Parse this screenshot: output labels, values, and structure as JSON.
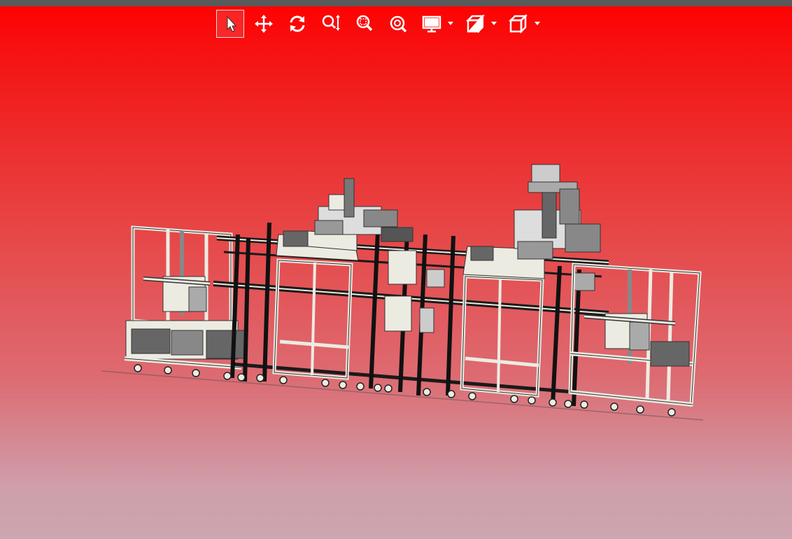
{
  "toolbar": {
    "tools": [
      {
        "name": "select",
        "icon": "cursor-arrow-icon",
        "active": true
      },
      {
        "name": "pan",
        "icon": "move-arrows-icon",
        "active": false
      },
      {
        "name": "rotate",
        "icon": "rotate-icon",
        "active": false
      },
      {
        "name": "zoom",
        "icon": "zoom-updown-icon",
        "active": false
      },
      {
        "name": "zoom-window",
        "icon": "zoom-window-icon",
        "active": false
      },
      {
        "name": "zoom-fit",
        "icon": "zoom-fit-icon",
        "active": false
      }
    ],
    "dropdowns": [
      {
        "name": "display-mode",
        "icon": "monitor-icon"
      },
      {
        "name": "section-view",
        "icon": "section-cube-icon"
      },
      {
        "name": "standard-views",
        "icon": "cube-icon"
      }
    ]
  },
  "colors": {
    "background_top": "#ff0000",
    "background_bottom": "#cca6b0",
    "topbar": "#5a5a5a",
    "icon": "#ffffff",
    "model_frame": "#ecebe2",
    "model_dark": "#1a1a1a"
  },
  "model": {
    "description_icon": "assembly-line-3d-model"
  }
}
